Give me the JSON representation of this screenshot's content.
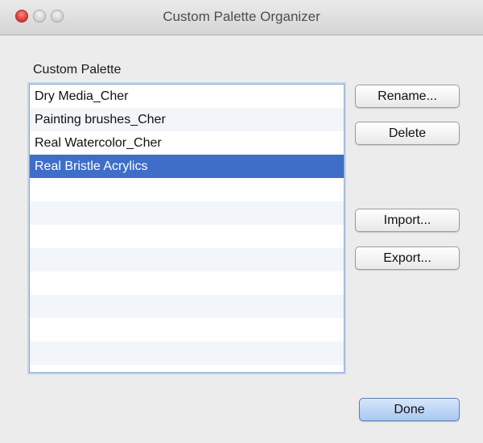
{
  "window": {
    "title": "Custom Palette Organizer"
  },
  "palette_section": {
    "label": "Custom Palette",
    "items": [
      {
        "label": "Dry Media_Cher",
        "selected": false
      },
      {
        "label": "Painting brushes_Cher",
        "selected": false
      },
      {
        "label": "Real Watercolor_Cher",
        "selected": false
      },
      {
        "label": "Real Bristle Acrylics",
        "selected": true
      }
    ],
    "empty_rows": 8
  },
  "buttons": {
    "rename": "Rename...",
    "delete": "Delete",
    "import": "Import...",
    "export": "Export...",
    "done": "Done"
  },
  "colors": {
    "selection": "#3f6ec9",
    "close_button": "#e0443c",
    "done_button": "#a9c8f0"
  },
  "icons": [
    "close-icon",
    "minimize-icon",
    "zoom-icon"
  ]
}
